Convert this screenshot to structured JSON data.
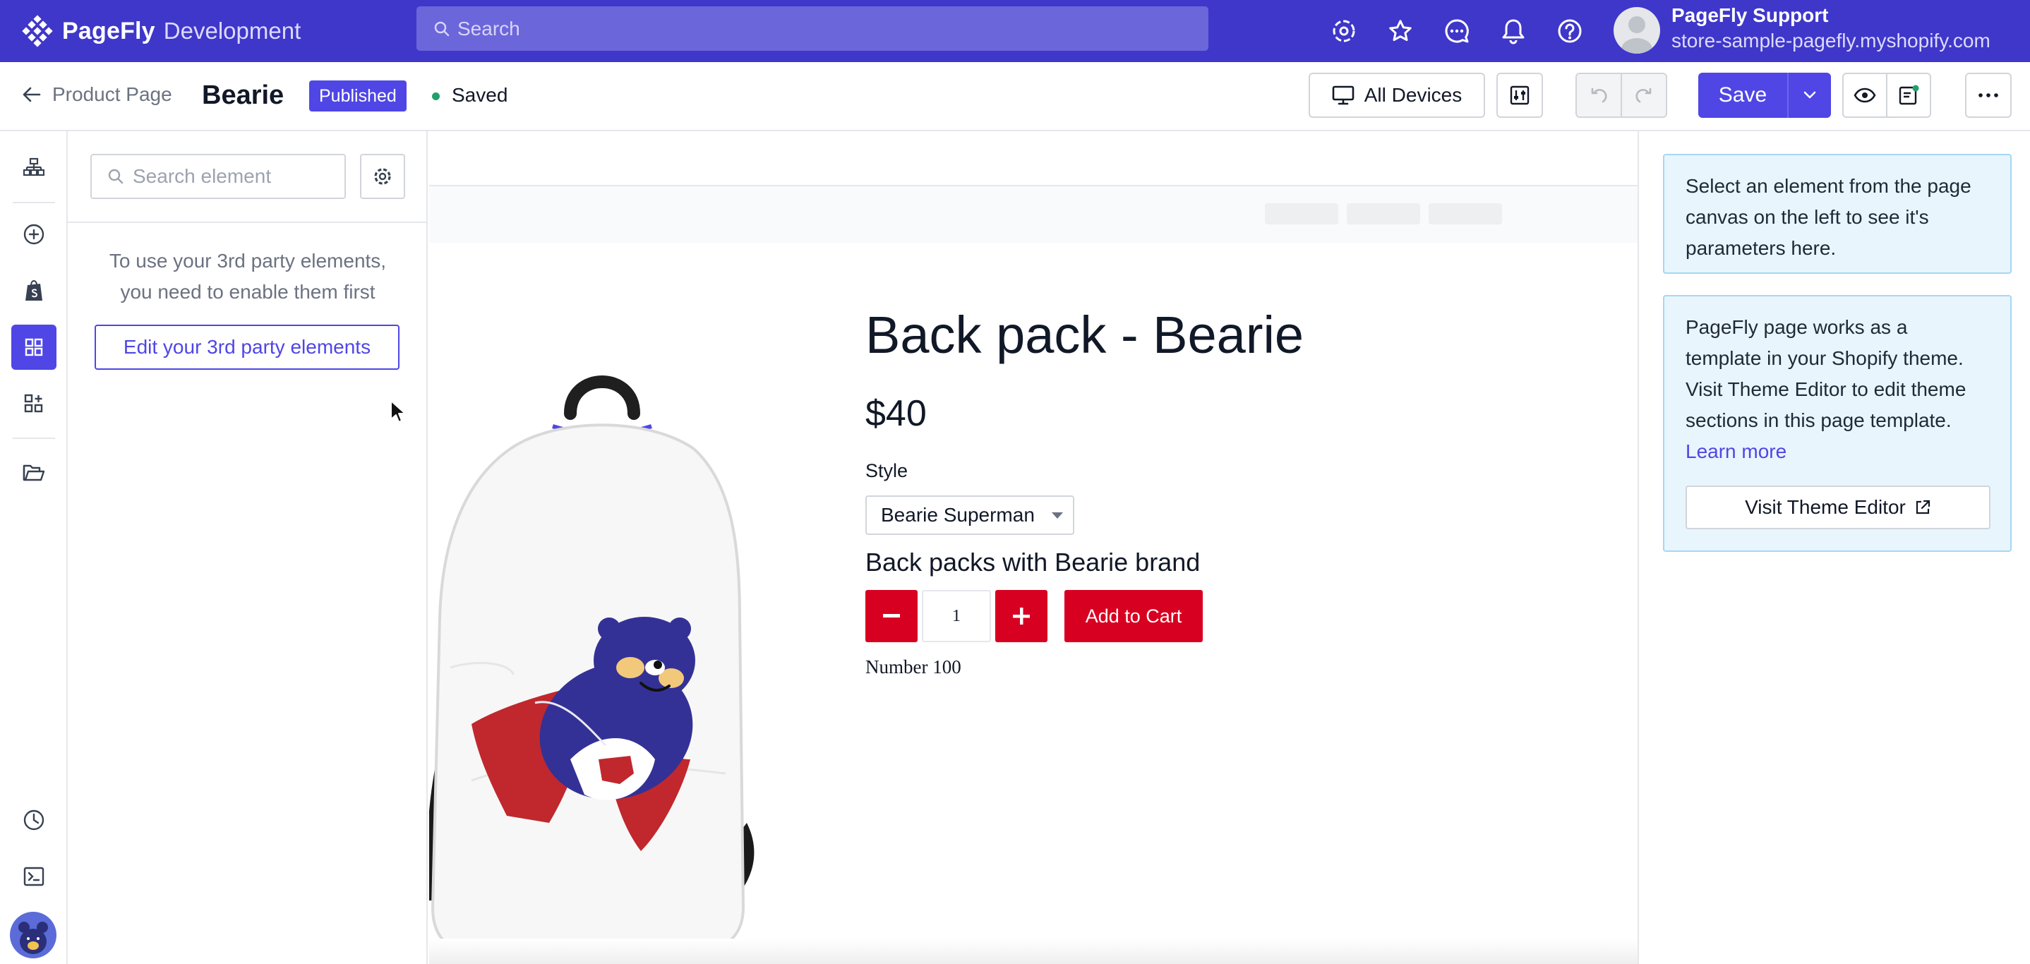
{
  "topbar": {
    "brand": "PageFly",
    "environment": "Development",
    "search_placeholder": "Search",
    "icons": [
      "gear-icon",
      "star-icon",
      "chat-icon",
      "bell-icon",
      "help-icon"
    ],
    "account_name": "PageFly Support",
    "account_store": "store-sample-pagefly.myshopify.com"
  },
  "header": {
    "back_label": "Product Page",
    "page_name": "Bearie",
    "status_badge": "Published",
    "save_status": "Saved",
    "devices_label": "All Devices",
    "save_label": "Save"
  },
  "rail": {
    "items": [
      "sitemap-icon",
      "add-icon",
      "shopify-icon",
      "elements-icon",
      "widgets-icon",
      "folder-icon",
      "history-icon",
      "terminal-icon"
    ],
    "active": "elements-icon"
  },
  "panel": {
    "search_placeholder": "Search element",
    "message_line1": "To use your 3rd party elements,",
    "message_line2": "you need to enable them first",
    "edit_button": "Edit your 3rd party elements"
  },
  "product": {
    "title": "Back pack - Bearie",
    "price": "$40",
    "style_label": "Style",
    "style_value": "Bearie Superman",
    "subheading": "Back packs with Bearie brand",
    "quantity": "1",
    "add_to_cart": "Add to Cart",
    "number_text": "Number 100"
  },
  "right_panel": {
    "hint_lines": [
      "Select an element from the page",
      "canvas on the left to see it's",
      "parameters here."
    ],
    "theme_lines": [
      "PageFly page works as a",
      "template in your Shopify theme.",
      "Visit Theme Editor to edit theme",
      "sections in this page template."
    ],
    "learn_more": "Learn more",
    "visit_button": "Visit Theme Editor"
  },
  "colors": {
    "brand_purple": "#3f37c9",
    "accent_indigo": "#4f46e5",
    "cart_red": "#d70021",
    "info_blue_bg": "#e8f5fd",
    "saved_green": "#22a06b"
  }
}
